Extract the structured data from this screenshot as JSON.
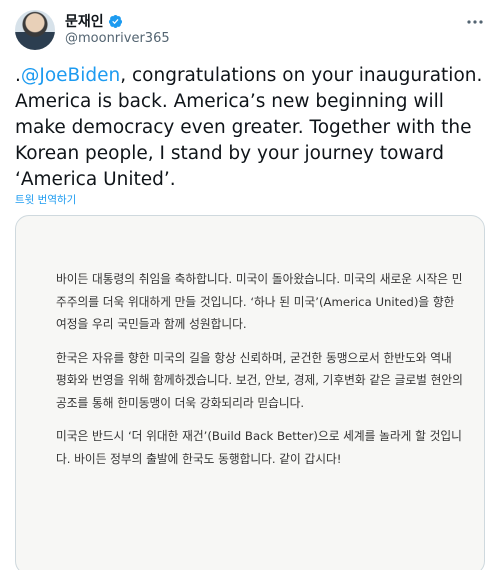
{
  "header": {
    "display_name": "문재인",
    "handle": "@moonriver365",
    "verified_color": "#1d9bf0",
    "more_icon": "more-icon"
  },
  "tweet": {
    "prefix": ".",
    "mention": "@JoeBiden",
    "body": ", congratulations on your inauguration. America is back. America’s new beginning will make democracy even greater. Together with the Korean people, I stand by your journey toward ‘America United’."
  },
  "translate_link": "트윗 번역하기",
  "image_letter": {
    "paragraphs": [
      "바이든 대통령의 취임을 축하합니다. 미국이 돌아왔습니다. 미국의 새로운 시작은 민주주의를 더욱 위대하게 만들 것입니다. ‘하나 된 미국’(America United)을 향한 여정을 우리 국민들과 함께 성원합니다.",
      "한국은 자유를 향한 미국의 길을 항상 신뢰하며, 굳건한 동맹으로서 한반도와 역내 평화와 번영을 위해 함께하겠습니다. 보건, 안보, 경제, 기후변화 같은 글로벌 현안의 공조를 통해 한미동맹이 더욱 강화되리라 믿습니다.",
      "미국은 반드시 ‘더 위대한 재건’(Build Back Better)으로 세계를 놀라게 할 것입니다. 바이든 정부의 출발에 한국도 동행합니다. 같이 갑시다!"
    ]
  }
}
